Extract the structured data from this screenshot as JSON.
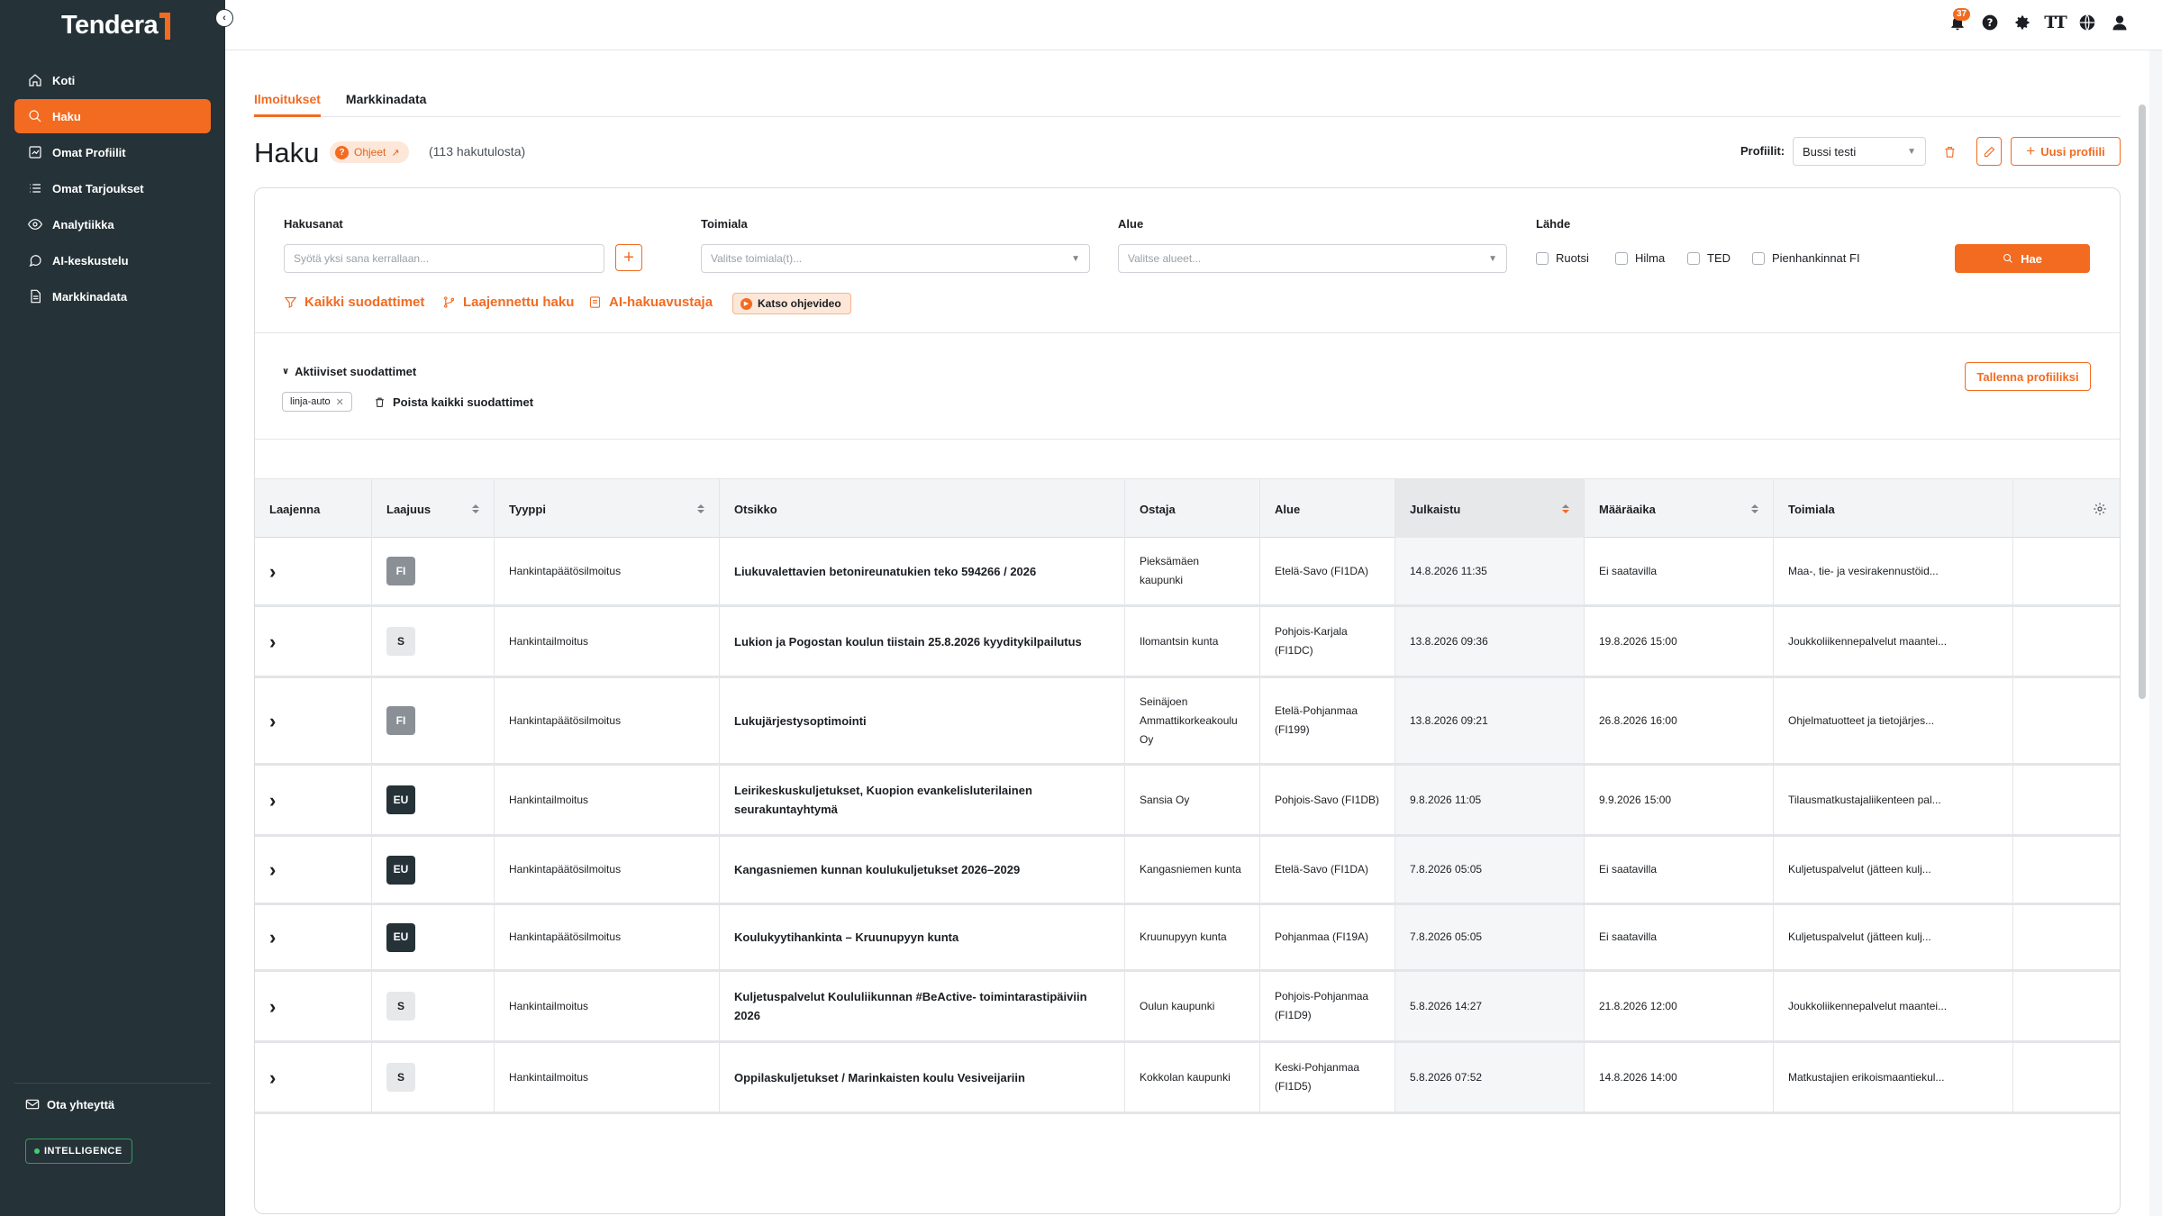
{
  "app": {
    "logo": "Tendera"
  },
  "sidebar": {
    "items": [
      {
        "label": "Koti",
        "icon": "home-icon",
        "active": false
      },
      {
        "label": "Haku",
        "icon": "search-icon",
        "active": true
      },
      {
        "label": "Omat Profiilit",
        "icon": "chart-icon",
        "active": false
      },
      {
        "label": "Omat Tarjoukset",
        "icon": "list-icon",
        "active": false
      },
      {
        "label": "Analytiikka",
        "icon": "eye-icon",
        "active": false
      },
      {
        "label": "AI-keskustelu",
        "icon": "chat-icon",
        "active": false
      },
      {
        "label": "Markkinadata",
        "icon": "document-icon",
        "active": false
      }
    ],
    "contact": "Ota yhteyttä",
    "badge": "INTELLIGENCE"
  },
  "topbar": {
    "notification_count": "37",
    "text_size_icon": "TT"
  },
  "tabs": [
    {
      "label": "Ilmoitukset",
      "active": true
    },
    {
      "label": "Markkinadata",
      "active": false
    }
  ],
  "header": {
    "title": "Haku",
    "help_label": "Ohjeet",
    "result_count": "(113 hakutulosta)",
    "profile_label": "Profiilit:",
    "profile_value": "Bussi testi",
    "new_profile": "Uusi profiili"
  },
  "filters": {
    "keywords_label": "Hakusanat",
    "keywords_placeholder": "Syötä yksi sana kerrallaan...",
    "industry_label": "Toimiala",
    "industry_placeholder": "Valitse toimiala(t)...",
    "region_label": "Alue",
    "region_placeholder": "Valitse alueet...",
    "source_label": "Lähde",
    "sources": [
      "Ruotsi",
      "Hilma",
      "TED",
      "Pienhankinnat FI"
    ],
    "search_button": "Hae",
    "all_filters": "Kaikki suodattimet",
    "extended_search": "Laajennettu haku",
    "ai_assistant": "AI-hakuavustaja",
    "video": "Katso ohjevideo",
    "active_filters": "Aktiiviset suodattimet",
    "chip": "linja-auto",
    "clear_all": "Poista kaikki suodattimet",
    "save_profile": "Tallenna profiiliksi"
  },
  "table": {
    "columns": [
      "Laajenna",
      "Laajuus",
      "Tyyppi",
      "Otsikko",
      "Ostaja",
      "Alue",
      "Julkaistu",
      "Määräaika",
      "Toimiala"
    ],
    "rows": [
      {
        "scope": "FI",
        "type": "Hankintapäätösilmoitus",
        "title": "Liukuvalettavien betonireunatukien teko 594266 / 2026",
        "buyer": "Pieksämäen kaupunki",
        "region": "Etelä-Savo (FI1DA)",
        "published": "14.8.2026 11:35",
        "deadline": "Ei saatavilla",
        "industry": "Maa-, tie- ja vesirakennustöid..."
      },
      {
        "scope": "S",
        "type": "Hankintailmoitus",
        "title": "Lukion ja Pogostan koulun tiistain 25.8.2026 kyyditykilpailutus",
        "buyer": "Ilomantsin kunta",
        "region": "Pohjois-Karjala (FI1DC)",
        "published": "13.8.2026 09:36",
        "deadline": "19.8.2026 15:00",
        "industry": "Joukkoliikennepalvelut maantei..."
      },
      {
        "scope": "FI",
        "type": "Hankintapäätösilmoitus",
        "title": "Lukujärjestysoptimointi",
        "buyer": "Seinäjoen Ammattikorkeakoulu Oy",
        "region": "Etelä-Pohjanmaa (FI199)",
        "published": "13.8.2026 09:21",
        "deadline": "26.8.2026 16:00",
        "industry": "Ohjelmatuotteet ja tietojärjes..."
      },
      {
        "scope": "EU",
        "type": "Hankintailmoitus",
        "title": "Leirikeskuskuljetukset, Kuopion evankelisluterilainen seurakuntayhtymä",
        "buyer": "Sansia Oy",
        "region": "Pohjois-Savo (FI1DB)",
        "published": "9.8.2026 11:05",
        "deadline": "9.9.2026 15:00",
        "industry": "Tilausmatkustajaliikenteen pal..."
      },
      {
        "scope": "EU",
        "type": "Hankintapäätösilmoitus",
        "title": "Kangasniemen kunnan koulukuljetukset 2026–2029",
        "buyer": "Kangasniemen kunta",
        "region": "Etelä-Savo (FI1DA)",
        "published": "7.8.2026 05:05",
        "deadline": "Ei saatavilla",
        "industry": "Kuljetuspalvelut (jätteen kulj..."
      },
      {
        "scope": "EU",
        "type": "Hankintapäätösilmoitus",
        "title": "Koulukyytihankinta – Kruunupyyn kunta",
        "buyer": "Kruunupyyn kunta",
        "region": "Pohjanmaa (FI19A)",
        "published": "7.8.2026 05:05",
        "deadline": "Ei saatavilla",
        "industry": "Kuljetuspalvelut (jätteen kulj..."
      },
      {
        "scope": "S",
        "type": "Hankintailmoitus",
        "title": "Kuljetuspalvelut Koululiikunnan #BeActive- toimintarastipäiviin 2026",
        "buyer": "Oulun kaupunki",
        "region": "Pohjois-Pohjanmaa (FI1D9)",
        "published": "5.8.2026 14:27",
        "deadline": "21.8.2026 12:00",
        "industry": "Joukkoliikennepalvelut maantei..."
      },
      {
        "scope": "S",
        "type": "Hankintailmoitus",
        "title": "Oppilaskuljetukset / Marinkaisten koulu Vesiveijariin",
        "buyer": "Kokkolan kaupunki",
        "region": "Keski-Pohjanmaa (FI1D5)",
        "published": "5.8.2026 07:52",
        "deadline": "14.8.2026 14:00",
        "industry": "Matkustajien erikoismaantiekul..."
      }
    ]
  },
  "colors": {
    "accent": "#f26b21",
    "sidebar": "#253238",
    "eu_badge": "#253238",
    "fi_badge": "#8a9096"
  }
}
